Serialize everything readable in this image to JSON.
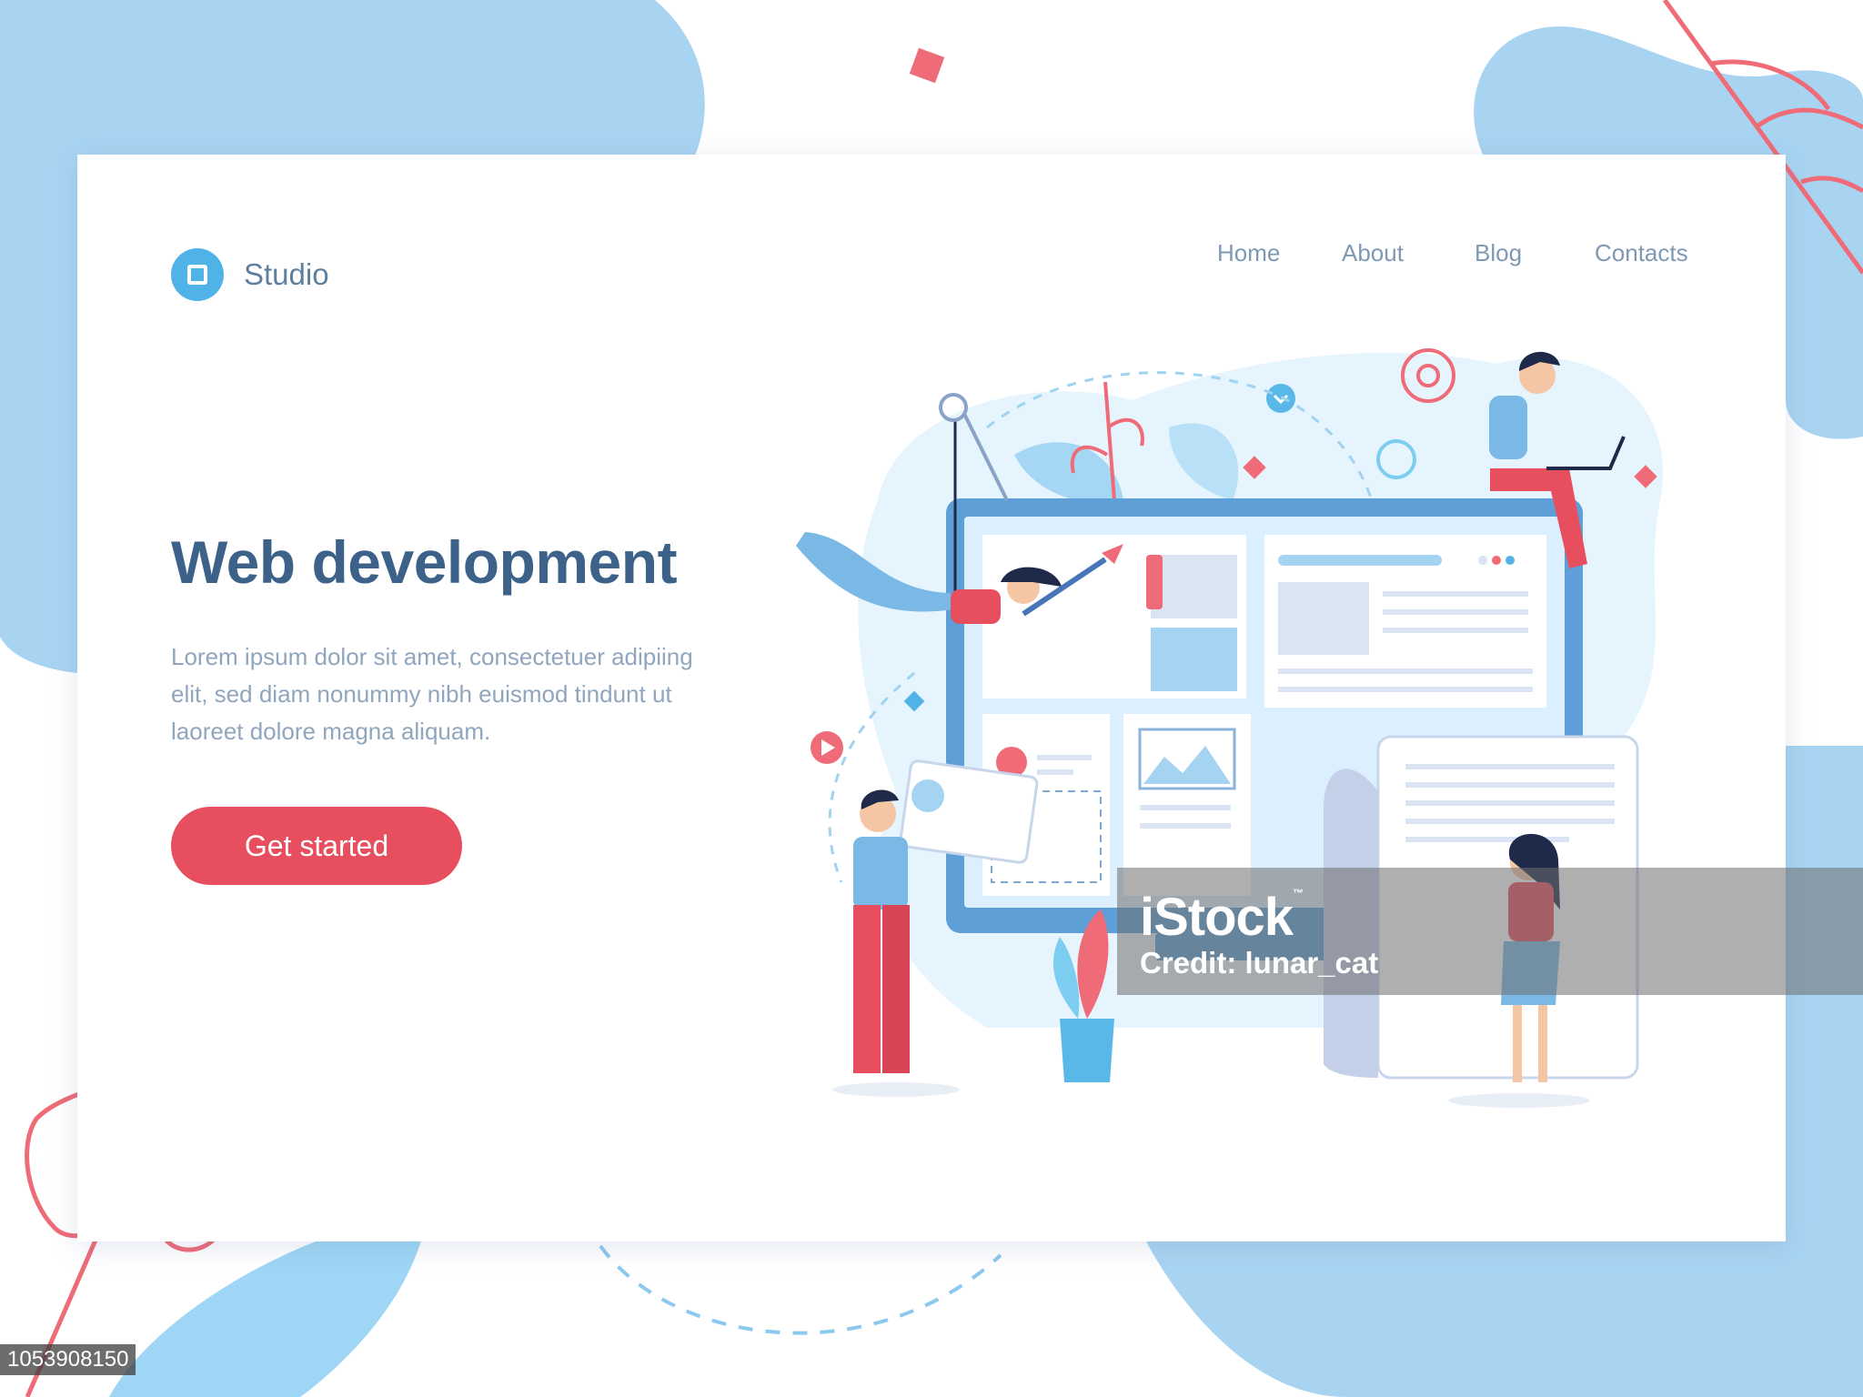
{
  "brand": {
    "name": "Studio",
    "icon": "square-logo-icon"
  },
  "nav": {
    "items": [
      {
        "label": "Home"
      },
      {
        "label": "About"
      },
      {
        "label": "Blog"
      },
      {
        "label": "Contacts"
      }
    ]
  },
  "hero": {
    "title": "Web development",
    "body": "Lorem ipsum dolor sit amet, consectetuer adipiing elit, sed diam nonummy nibh euismod tindunt ut laoreet dolore magna aliquam.",
    "cta_label": "Get started"
  },
  "watermark": {
    "brand": "iStock",
    "tm": "™",
    "credit": "Credit: lunar_cat",
    "stock_id": "1053908150"
  },
  "colors": {
    "accent": "#e74f5f",
    "primary_blue": "#4fb3e8",
    "heading": "#3d6289",
    "body_text": "#8fa6be",
    "nav_text": "#7f99b5",
    "pale_blue": "#a5d3f2"
  }
}
